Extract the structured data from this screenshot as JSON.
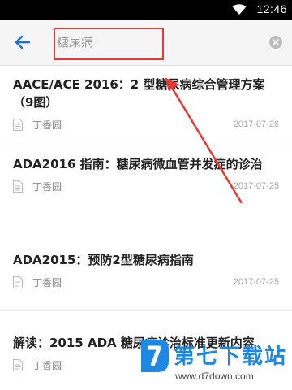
{
  "status_bar": {
    "time": "12:46",
    "wifi_icon": "wifi-icon"
  },
  "search": {
    "query": "糖尿病",
    "back_icon": "arrow-left-icon",
    "clear_icon": "close-circle-icon"
  },
  "results": [
    {
      "title": "AACE/ACE 2016：2 型糖尿病综合管理方案（9图）",
      "source": "丁香园",
      "date": "2017-07-26"
    },
    {
      "title": "ADA2016 指南：糖尿病微血管并发症的诊治",
      "source": "丁香园",
      "date": "2017-07-25"
    },
    {
      "title": "ADA2015：预防2型糖尿病指南",
      "source": "丁香园",
      "date": "2017-07-25"
    },
    {
      "title": "解读：2015 ADA 糖尿病诊治标准更新内容",
      "source": "丁香园",
      "date": ""
    }
  ],
  "annotation": {
    "color": "#e53935"
  },
  "watermark": {
    "name": "第七下载站",
    "url": "www.d7down.com",
    "color": "#1e88e5"
  }
}
